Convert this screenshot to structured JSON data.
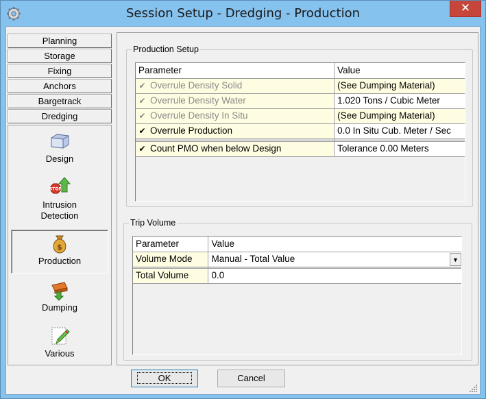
{
  "window": {
    "title": "Session Setup - Dredging -  Production",
    "close_label": "✕"
  },
  "nav": {
    "tabs": [
      "Planning",
      "Storage",
      "Fixing",
      "Anchors",
      "Bargetrack",
      "Dredging"
    ],
    "items": [
      {
        "label": "Design",
        "icon": "design-box-icon"
      },
      {
        "label": "Intrusion\nDetection",
        "icon": "stop-sign-icon"
      },
      {
        "label": "Production",
        "icon": "money-bag-icon",
        "selected": true
      },
      {
        "label": "Dumping",
        "icon": "dumping-icon"
      },
      {
        "label": "Various",
        "icon": "edit-pencil-icon"
      }
    ]
  },
  "production_setup": {
    "title": "Production Setup",
    "col_param": "Parameter",
    "col_value": "Value",
    "rows": [
      {
        "param": "Overrule Density Solid",
        "value": "(See Dumping Material)",
        "checked": true,
        "disabled": true
      },
      {
        "param": "Overrule Density Water",
        "value": "1.020 Tons / Cubic Meter",
        "checked": true,
        "disabled": true
      },
      {
        "param": "Overrule Density In Situ",
        "value": "(See Dumping Material)",
        "checked": true,
        "disabled": true
      },
      {
        "param": "Overrule Production",
        "value": "0.0 In Situ Cub. Meter / Sec",
        "checked": true,
        "disabled": false
      },
      {
        "param": "Count PMO when below Design",
        "value": "Tolerance 0.00 Meters",
        "checked": true,
        "disabled": false
      }
    ]
  },
  "trip_volume": {
    "title": "Trip Volume",
    "col_param": "Parameter",
    "col_value": "Value",
    "rows": [
      {
        "param": "Volume Mode",
        "value": "Manual - Total Value"
      },
      {
        "param": "Total Volume",
        "value": "0.0"
      }
    ]
  },
  "buttons": {
    "ok": "OK",
    "cancel": "Cancel"
  },
  "check_glyph": "✔"
}
